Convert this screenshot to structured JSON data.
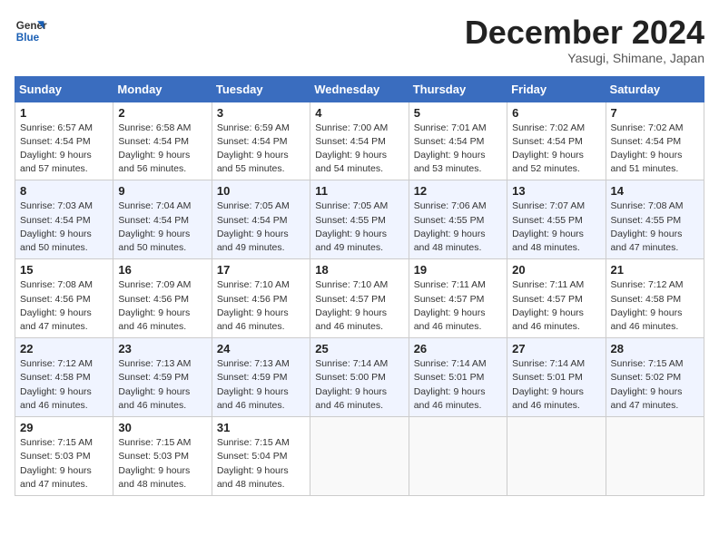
{
  "logo": {
    "line1": "General",
    "line2": "Blue"
  },
  "title": "December 2024",
  "subtitle": "Yasugi, Shimane, Japan",
  "days_of_week": [
    "Sunday",
    "Monday",
    "Tuesday",
    "Wednesday",
    "Thursday",
    "Friday",
    "Saturday"
  ],
  "weeks": [
    [
      {
        "day": 1,
        "info": "Sunrise: 6:57 AM\nSunset: 4:54 PM\nDaylight: 9 hours\nand 57 minutes."
      },
      {
        "day": 2,
        "info": "Sunrise: 6:58 AM\nSunset: 4:54 PM\nDaylight: 9 hours\nand 56 minutes."
      },
      {
        "day": 3,
        "info": "Sunrise: 6:59 AM\nSunset: 4:54 PM\nDaylight: 9 hours\nand 55 minutes."
      },
      {
        "day": 4,
        "info": "Sunrise: 7:00 AM\nSunset: 4:54 PM\nDaylight: 9 hours\nand 54 minutes."
      },
      {
        "day": 5,
        "info": "Sunrise: 7:01 AM\nSunset: 4:54 PM\nDaylight: 9 hours\nand 53 minutes."
      },
      {
        "day": 6,
        "info": "Sunrise: 7:02 AM\nSunset: 4:54 PM\nDaylight: 9 hours\nand 52 minutes."
      },
      {
        "day": 7,
        "info": "Sunrise: 7:02 AM\nSunset: 4:54 PM\nDaylight: 9 hours\nand 51 minutes."
      }
    ],
    [
      {
        "day": 8,
        "info": "Sunrise: 7:03 AM\nSunset: 4:54 PM\nDaylight: 9 hours\nand 50 minutes."
      },
      {
        "day": 9,
        "info": "Sunrise: 7:04 AM\nSunset: 4:54 PM\nDaylight: 9 hours\nand 50 minutes."
      },
      {
        "day": 10,
        "info": "Sunrise: 7:05 AM\nSunset: 4:54 PM\nDaylight: 9 hours\nand 49 minutes."
      },
      {
        "day": 11,
        "info": "Sunrise: 7:05 AM\nSunset: 4:55 PM\nDaylight: 9 hours\nand 49 minutes."
      },
      {
        "day": 12,
        "info": "Sunrise: 7:06 AM\nSunset: 4:55 PM\nDaylight: 9 hours\nand 48 minutes."
      },
      {
        "day": 13,
        "info": "Sunrise: 7:07 AM\nSunset: 4:55 PM\nDaylight: 9 hours\nand 48 minutes."
      },
      {
        "day": 14,
        "info": "Sunrise: 7:08 AM\nSunset: 4:55 PM\nDaylight: 9 hours\nand 47 minutes."
      }
    ],
    [
      {
        "day": 15,
        "info": "Sunrise: 7:08 AM\nSunset: 4:56 PM\nDaylight: 9 hours\nand 47 minutes."
      },
      {
        "day": 16,
        "info": "Sunrise: 7:09 AM\nSunset: 4:56 PM\nDaylight: 9 hours\nand 46 minutes."
      },
      {
        "day": 17,
        "info": "Sunrise: 7:10 AM\nSunset: 4:56 PM\nDaylight: 9 hours\nand 46 minutes."
      },
      {
        "day": 18,
        "info": "Sunrise: 7:10 AM\nSunset: 4:57 PM\nDaylight: 9 hours\nand 46 minutes."
      },
      {
        "day": 19,
        "info": "Sunrise: 7:11 AM\nSunset: 4:57 PM\nDaylight: 9 hours\nand 46 minutes."
      },
      {
        "day": 20,
        "info": "Sunrise: 7:11 AM\nSunset: 4:57 PM\nDaylight: 9 hours\nand 46 minutes."
      },
      {
        "day": 21,
        "info": "Sunrise: 7:12 AM\nSunset: 4:58 PM\nDaylight: 9 hours\nand 46 minutes."
      }
    ],
    [
      {
        "day": 22,
        "info": "Sunrise: 7:12 AM\nSunset: 4:58 PM\nDaylight: 9 hours\nand 46 minutes."
      },
      {
        "day": 23,
        "info": "Sunrise: 7:13 AM\nSunset: 4:59 PM\nDaylight: 9 hours\nand 46 minutes."
      },
      {
        "day": 24,
        "info": "Sunrise: 7:13 AM\nSunset: 4:59 PM\nDaylight: 9 hours\nand 46 minutes."
      },
      {
        "day": 25,
        "info": "Sunrise: 7:14 AM\nSunset: 5:00 PM\nDaylight: 9 hours\nand 46 minutes."
      },
      {
        "day": 26,
        "info": "Sunrise: 7:14 AM\nSunset: 5:01 PM\nDaylight: 9 hours\nand 46 minutes."
      },
      {
        "day": 27,
        "info": "Sunrise: 7:14 AM\nSunset: 5:01 PM\nDaylight: 9 hours\nand 46 minutes."
      },
      {
        "day": 28,
        "info": "Sunrise: 7:15 AM\nSunset: 5:02 PM\nDaylight: 9 hours\nand 47 minutes."
      }
    ],
    [
      {
        "day": 29,
        "info": "Sunrise: 7:15 AM\nSunset: 5:03 PM\nDaylight: 9 hours\nand 47 minutes."
      },
      {
        "day": 30,
        "info": "Sunrise: 7:15 AM\nSunset: 5:03 PM\nDaylight: 9 hours\nand 48 minutes."
      },
      {
        "day": 31,
        "info": "Sunrise: 7:15 AM\nSunset: 5:04 PM\nDaylight: 9 hours\nand 48 minutes."
      },
      null,
      null,
      null,
      null
    ]
  ]
}
